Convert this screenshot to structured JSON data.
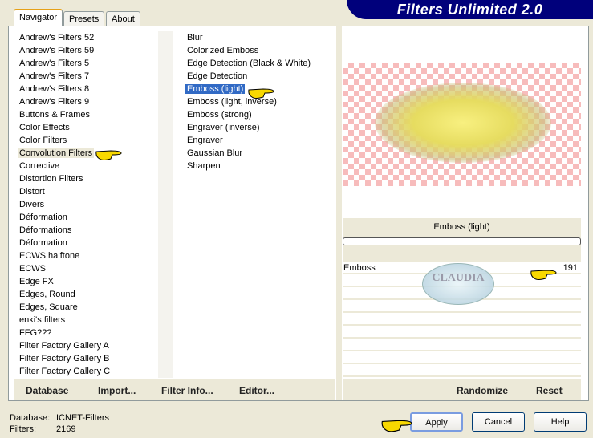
{
  "banner": {
    "title": "Filters Unlimited 2.0"
  },
  "tabs": [
    {
      "label": "Navigator"
    },
    {
      "label": "Presets"
    },
    {
      "label": "About"
    }
  ],
  "categories": [
    "Andrew's Filters 52",
    "Andrew's Filters 59",
    "Andrew's Filters 5",
    "Andrew's Filters 7",
    "Andrew's Filters 8",
    "Andrew's Filters 9",
    "Buttons & Frames",
    "Color Effects",
    "Color Filters",
    "Convolution Filters",
    "Corrective",
    "Distortion Filters",
    "Distort",
    "Divers",
    "Déformation",
    "Déformations",
    "Déformation",
    "ECWS halftone",
    "ECWS",
    "Edge FX",
    "Edges, Round",
    "Edges, Square",
    "enki's filters",
    "FFG???",
    "Filter Factory Gallery A",
    "Filter Factory Gallery B",
    "Filter Factory Gallery C"
  ],
  "selected_category": "Convolution Filters",
  "filters": [
    "Blur",
    "Colorized Emboss",
    "Edge Detection (Black & White)",
    "Edge Detection",
    "Emboss (light)",
    "Emboss (light, inverse)",
    "Emboss (strong)",
    "Engraver (inverse)",
    "Engraver",
    "Gaussian Blur",
    "Sharpen"
  ],
  "selected_filter": "Emboss (light)",
  "preview": {
    "filter_name": "Emboss (light)",
    "progress": 0
  },
  "sliders": [
    {
      "label": "Emboss",
      "value": "191"
    }
  ],
  "watermark": "CLAUDIA",
  "bottom_left_buttons": [
    "Database",
    "Import...",
    "Filter Info...",
    "Editor..."
  ],
  "bottom_right_buttons": [
    "Randomize",
    "Reset"
  ],
  "status": {
    "database_label": "Database:",
    "database_value": "ICNET-Filters",
    "filters_label": "Filters:",
    "filters_value": "2169"
  },
  "dialog_buttons": {
    "apply": "Apply",
    "cancel": "Cancel",
    "help": "Help"
  },
  "colors": {
    "selection": "#316ac5",
    "banner": "#00007b",
    "pointer": "#f8d800"
  }
}
